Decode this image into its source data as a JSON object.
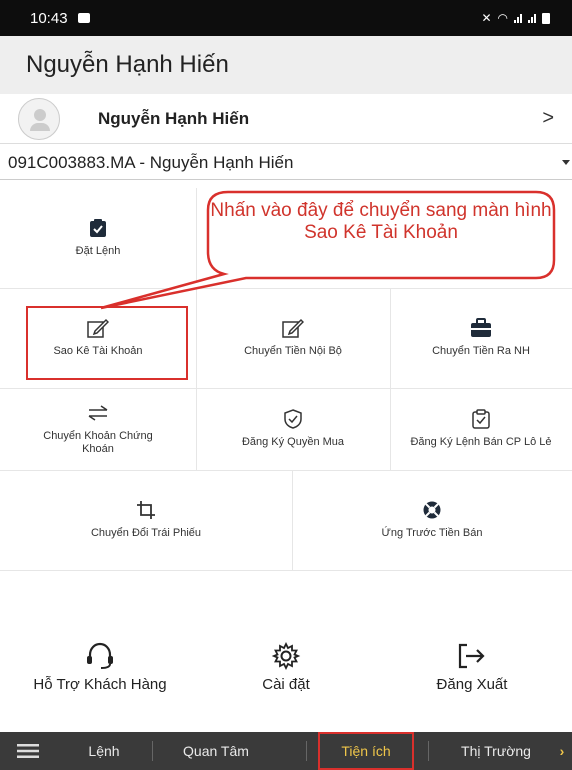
{
  "status_bar": {
    "time": "10:43"
  },
  "header": {
    "title": "Nguyễn Hạnh Hiến"
  },
  "user": {
    "name": "Nguyễn Hạnh Hiến",
    "chevron": ">"
  },
  "account": {
    "label": "091C003883.MA - Nguyễn Hạnh Hiến"
  },
  "menu": {
    "dat_lenh": "Đặt Lệnh",
    "sao_ke": "Sao Kê Tài Khoản",
    "chuyen_tien_noi_bo": "Chuyển Tiền Nội Bộ",
    "chuyen_tien_ra_nh": "Chuyển Tiền Ra NH",
    "chuyen_khoan_ck": "Chuyển Khoản Chứng Khoán",
    "dang_ky_quyen_mua": "Đăng Ký Quyền Mua",
    "dang_ky_lenh_ban": "Đăng Ký Lệnh Bán CP Lô Lẻ",
    "chuyen_doi_trai_phieu": "Chuyển Đổi Trái Phiếu",
    "ung_truoc_tien_ban": "Ứng Trước Tiền Bán"
  },
  "annotation": {
    "text": "Nhấn vào đây để chuyển sang màn hình Sao Kê Tài Khoản"
  },
  "actions": {
    "support": "Hỗ Trợ Khách Hàng",
    "settings": "Cài đặt",
    "logout": "Đăng Xuất"
  },
  "tabs": [
    "Lệnh",
    "Quan Tâm",
    "Tiện ích",
    "Thị Trường"
  ],
  "colors": {
    "highlight": "#d9302c",
    "active_tab": "#f0c64a",
    "tabbar": "#3a3a3a"
  },
  "icons": {
    "avatar": "person-icon",
    "dat_lenh": "clipboard-check-icon",
    "sao_ke": "edit-icon",
    "chuyen_tien_noi_bo": "edit-icon",
    "chuyen_tien_ra_nh": "briefcase-icon",
    "chuyen_khoan_ck": "transfer-arrows-icon",
    "dang_ky_quyen_mua": "shield-check-icon",
    "dang_ky_lenh_ban": "clipboard-check-icon",
    "chuyen_doi_trai_phieu": "crop-icon",
    "ung_truoc_tien_ban": "lifebuoy-icon",
    "support": "headset-icon",
    "settings": "gear-icon",
    "logout": "logout-icon",
    "menu": "hamburger-icon",
    "more": "chevron-right-icon"
  }
}
